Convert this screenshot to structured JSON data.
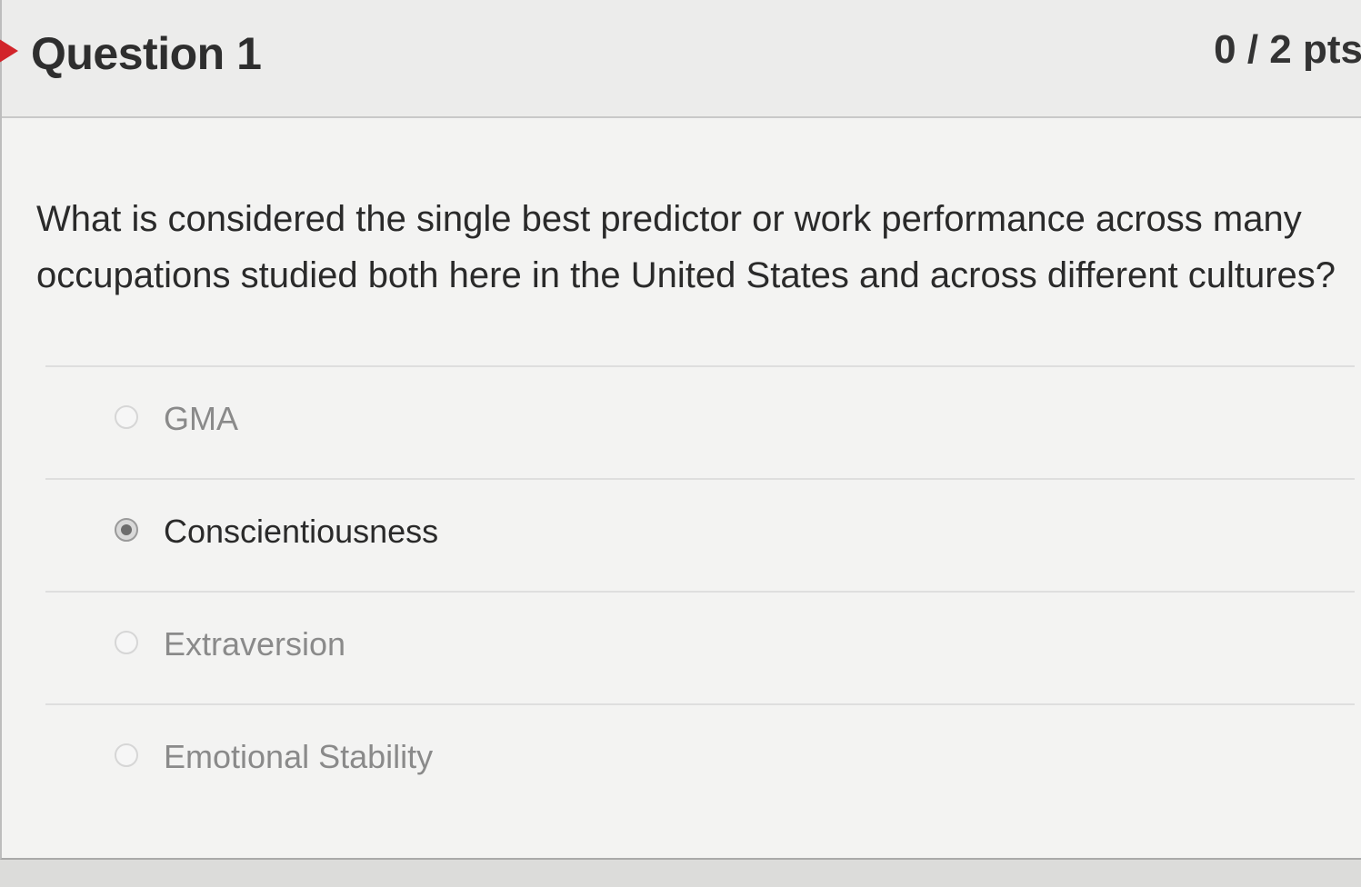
{
  "question": {
    "title": "Question 1",
    "points": "0 / 2 pts",
    "text": "What is considered the single best predictor or work performance across many occupations studied both here in the United States and across different cultures?"
  },
  "answers": [
    {
      "label": "GMA",
      "selected": false
    },
    {
      "label": "Conscientiousness",
      "selected": true
    },
    {
      "label": "Extraversion",
      "selected": false
    },
    {
      "label": "Emotional Stability",
      "selected": false
    }
  ],
  "colors": {
    "incorrect_marker": "#d2242a"
  }
}
